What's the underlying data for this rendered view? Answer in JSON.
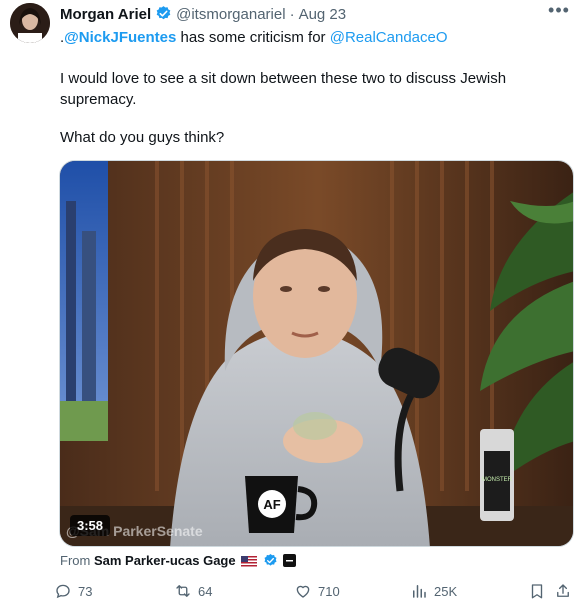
{
  "tweet": {
    "author_name": "Morgan Ariel",
    "author_handle": "@itsmorganariel",
    "separator": "·",
    "date": "Aug 23",
    "line1_prefix": ".",
    "mention1": "@NickJFuentes",
    "line1_middle": " has some criticism for ",
    "mention2": "@RealCandaceO",
    "text_line2": "I would love to see a sit down between these two to discuss Jewish",
    "text_line3": "supremacy.",
    "text_line4": "What do you guys think?"
  },
  "media": {
    "duration": "3:58",
    "watermark": "@Sam ParkerSenate",
    "mug_logo": "AF",
    "can_label": "MONSTER"
  },
  "source": {
    "prefix": "From ",
    "name": "Sam Parker-ucas Gage"
  },
  "actions": {
    "replies": "73",
    "reposts": "64",
    "likes": "710",
    "views": "25K"
  },
  "colors": {
    "accent": "#1d9bf0",
    "muted": "#536471",
    "text": "#0f1419"
  }
}
